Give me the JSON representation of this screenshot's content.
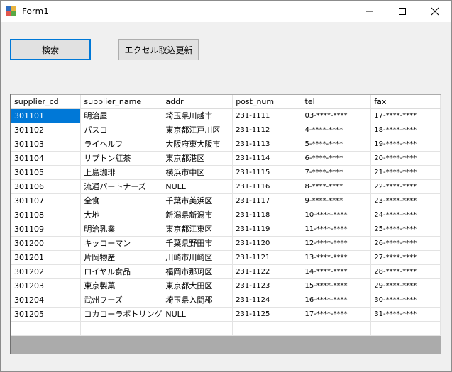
{
  "window": {
    "title": "Form1"
  },
  "buttons": {
    "search": "検索",
    "excel": "エクセル取込更新"
  },
  "grid": {
    "columns": [
      "supplier_cd",
      "supplier_name",
      "addr",
      "post_num",
      "tel",
      "fax"
    ],
    "rows": [
      [
        "301101",
        "明治屋",
        "埼玉県川越市",
        "231-1111",
        "03-****-****",
        "17-****-****"
      ],
      [
        "301102",
        "パスコ",
        "東京都江戸川区",
        "231-1112",
        "4-****-****",
        "18-****-****"
      ],
      [
        "301103",
        "ライヘルフ",
        "大阪府東大阪市",
        "231-1113",
        "5-****-****",
        "19-****-****"
      ],
      [
        "301104",
        "リプトン紅茶",
        "東京都港区",
        "231-1114",
        "6-****-****",
        "20-****-****"
      ],
      [
        "301105",
        "上島珈琲",
        "横浜市中区",
        "231-1115",
        "7-****-****",
        "21-****-****"
      ],
      [
        "301106",
        "流通パートナーズ",
        "NULL",
        "231-1116",
        "8-****-****",
        "22-****-****"
      ],
      [
        "301107",
        "全食",
        "千葉市美浜区",
        "231-1117",
        "9-****-****",
        "23-****-****"
      ],
      [
        "301108",
        "大地",
        "新潟県新潟市",
        "231-1118",
        "10-****-****",
        "24-****-****"
      ],
      [
        "301109",
        "明治乳業",
        "東京都江東区",
        "231-1119",
        "11-****-****",
        "25-****-****"
      ],
      [
        "301200",
        "キッコーマン",
        "千葉県野田市",
        "231-1120",
        "12-****-****",
        "26-****-****"
      ],
      [
        "301201",
        "片岡物産",
        "川崎市川崎区",
        "231-1121",
        "13-****-****",
        "27-****-****"
      ],
      [
        "301202",
        "ロイヤル食品",
        "福岡市那珂区",
        "231-1122",
        "14-****-****",
        "28-****-****"
      ],
      [
        "301203",
        "東京製菓",
        "東京都大田区",
        "231-1123",
        "15-****-****",
        "29-****-****"
      ],
      [
        "301204",
        "武州フーズ",
        "埼玉県入間郡",
        "231-1124",
        "16-****-****",
        "30-****-****"
      ],
      [
        "301205",
        "コカコーラボトリング",
        "NULL",
        "231-1125",
        "17-****-****",
        "31-****-****"
      ]
    ]
  },
  "icons": {
    "app": "form-app-icon",
    "minimize": "minimize-icon",
    "maximize": "maximize-icon",
    "close": "close-icon"
  },
  "colors": {
    "selection": "#0078d7",
    "button_focus": "#0078d7"
  }
}
